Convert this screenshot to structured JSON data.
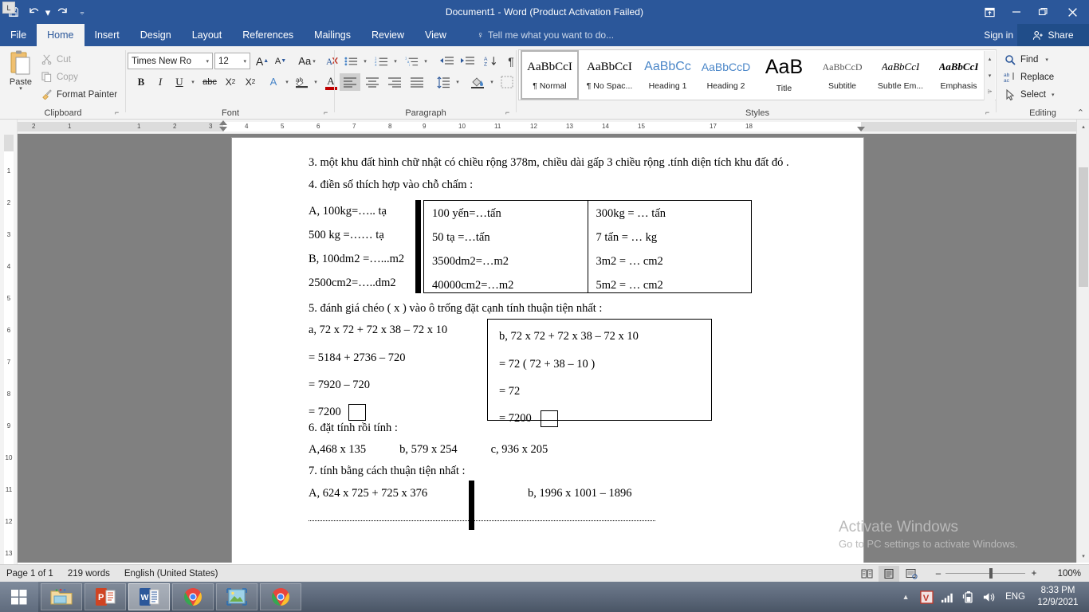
{
  "titlebar": {
    "document_title": "Document1 - Word (Product Activation Failed)",
    "qat": [
      {
        "name": "save",
        "label": "Save"
      },
      {
        "name": "undo",
        "label": "Undo"
      },
      {
        "name": "redo",
        "label": "Redo"
      },
      {
        "name": "customize",
        "label": "Customize Quick Access Toolbar"
      }
    ],
    "window_controls": [
      {
        "name": "ribbon-display-options",
        "label": "Ribbon Display Options"
      },
      {
        "name": "minimize",
        "label": "Minimize"
      },
      {
        "name": "restore",
        "label": "Restore Down"
      },
      {
        "name": "close",
        "label": "Close"
      }
    ]
  },
  "tabs": [
    {
      "label": "File",
      "active": false
    },
    {
      "label": "Home",
      "active": true
    },
    {
      "label": "Insert",
      "active": false
    },
    {
      "label": "Design",
      "active": false
    },
    {
      "label": "Layout",
      "active": false
    },
    {
      "label": "References",
      "active": false
    },
    {
      "label": "Mailings",
      "active": false
    },
    {
      "label": "Review",
      "active": false
    },
    {
      "label": "View",
      "active": false
    }
  ],
  "tellme": {
    "placeholder": "Tell me what you want to do..."
  },
  "account": {
    "signin": "Sign in",
    "share": "Share"
  },
  "ribbon": {
    "clipboard": {
      "group_label": "Clipboard",
      "paste_label": "Paste",
      "items": [
        {
          "label": "Cut",
          "icon": "scissors-icon",
          "enabled": false
        },
        {
          "label": "Copy",
          "icon": "copy-icon",
          "enabled": false
        },
        {
          "label": "Format Painter",
          "icon": "paintbrush-icon",
          "enabled": true
        }
      ]
    },
    "font": {
      "group_label": "Font",
      "font_name": "Times New Ro",
      "font_size": "12",
      "buttons": [
        {
          "name": "grow-font",
          "label": "A"
        },
        {
          "name": "shrink-font",
          "label": "A"
        },
        {
          "name": "change-case",
          "label": "Aa"
        },
        {
          "name": "clear-formatting",
          "label": "A"
        },
        {
          "name": "bold",
          "label": "B"
        },
        {
          "name": "italic",
          "label": "I"
        },
        {
          "name": "underline",
          "label": "U"
        },
        {
          "name": "strikethrough",
          "label": "abc"
        },
        {
          "name": "subscript",
          "label": "X2"
        },
        {
          "name": "superscript",
          "label": "X2"
        },
        {
          "name": "text-effects",
          "label": "A"
        },
        {
          "name": "text-highlight-color",
          "label": "ab"
        },
        {
          "name": "font-color",
          "label": "A"
        }
      ]
    },
    "paragraph": {
      "group_label": "Paragraph",
      "buttons": [
        {
          "name": "bullets"
        },
        {
          "name": "numbering"
        },
        {
          "name": "multilevel-list"
        },
        {
          "name": "decrease-indent"
        },
        {
          "name": "increase-indent"
        },
        {
          "name": "sort"
        },
        {
          "name": "show-formatting-marks"
        },
        {
          "name": "align-left"
        },
        {
          "name": "align-center"
        },
        {
          "name": "align-right"
        },
        {
          "name": "justify"
        },
        {
          "name": "line-spacing"
        },
        {
          "name": "shading"
        },
        {
          "name": "borders"
        }
      ]
    },
    "styles": {
      "group_label": "Styles",
      "items": [
        {
          "preview": "AaBbCcI",
          "name": "¶ Normal",
          "selected": true,
          "style": "serif-black"
        },
        {
          "preview": "AaBbCcI",
          "name": "¶ No Spac...",
          "selected": false,
          "style": "serif-black"
        },
        {
          "preview": "AaBbCc",
          "name": "Heading 1",
          "selected": false,
          "style": "sans-blue"
        },
        {
          "preview": "AaBbCcD",
          "name": "Heading 2",
          "selected": false,
          "style": "sans-blue"
        },
        {
          "preview": "AaB",
          "name": "Title",
          "selected": false,
          "style": "sans-big"
        },
        {
          "preview": "AaBbCcD",
          "name": "Subtitle",
          "selected": false,
          "style": "serif-small"
        },
        {
          "preview": "AaBbCcI",
          "name": "Subtle Em...",
          "selected": false,
          "style": "serif-italic"
        },
        {
          "preview": "AaBbCcI",
          "name": "Emphasis",
          "selected": false,
          "style": "serif-italic-bold"
        }
      ]
    },
    "editing": {
      "group_label": "Editing",
      "items": [
        {
          "label": "Find",
          "icon": "magnifier-icon",
          "has_caret": true
        },
        {
          "label": "Replace",
          "icon": "replace-icon",
          "has_caret": false
        },
        {
          "label": "Select",
          "icon": "cursor-icon",
          "has_caret": true
        }
      ]
    }
  },
  "ruler": {
    "horizontal_ticks": [
      "2",
      "1",
      "1",
      "2",
      "3",
      "4",
      "5",
      "6",
      "7",
      "8",
      "9",
      "10",
      "11",
      "12",
      "13",
      "14",
      "15",
      "17",
      "18"
    ],
    "vertical_ticks": [
      "1",
      "2",
      "3",
      "4",
      "5",
      "6",
      "7",
      "8",
      "9",
      "10",
      "11",
      "12",
      "13"
    ],
    "tab_selector": "L"
  },
  "document": {
    "q3": "3. một khu đất hình chữ nhật có chiều rộng 378m, chiều dài gấp 3 chiều rộng .tính diện tích khu đất đó .",
    "q4": "4. điền số thích hợp vào chỗ chấm :",
    "q4_left": [
      "A, 100kg=….. tạ",
      "500 kg =…… tạ",
      "B, 100dm2 =…...m2",
      "2500cm2=…..dm2"
    ],
    "q4_table_col1": [
      "100 yến=…tấn",
      "50 tạ =…tấn",
      "3500dm2=…m2",
      "40000cm2=…m2"
    ],
    "q4_table_col2": [
      "300kg = … tấn",
      "7 tấn = … kg",
      "3m2 = … cm2",
      "5m2 = … cm2"
    ],
    "q5": "5. đánh giá chéo ( x ) vào ô trống đặt cạnh tính thuậ tien nhất :",
    "q5_heading": "5. đánh giá chéo ( x ) vào ô trống đặt cạnh tính thuận tiện nhất :",
    "q5_left": [
      {
        "text": "a, 72 x 72 + 72 x 38 – 72 x 10",
        "box": false
      },
      {
        "text": "= 5184 + 2736 – 720",
        "box": false
      },
      {
        "text": "= 7920 – 720",
        "box": false
      },
      {
        "text": "= 7200",
        "box": true
      }
    ],
    "q5_box": [
      {
        "text": "b, 72 x 72 + 72 x 38 – 72 x 10",
        "box": false
      },
      {
        "text": "= 72 ( 72 + 38 – 10 )",
        "box": false
      },
      {
        "text": "= 72",
        "box": false
      },
      {
        "text": "= 7200",
        "box": true
      }
    ],
    "q6": "6. đặt tính rồi tính :",
    "q6_items": [
      "A,468 x 135",
      "b, 579 x 254",
      "c, 936 x 205"
    ],
    "q7": "7. tính bằng cách thuận tiện nhất :",
    "q7_a": "A, 624 x 725 + 725 x 376",
    "q7_b": "b, 1996 x 1001 – 1896"
  },
  "watermark": {
    "title": "Activate Windows",
    "subtitle": "Go to PC settings to activate Windows."
  },
  "statusbar": {
    "page": "Page 1 of 1",
    "words": "219 words",
    "language": "English (United States)",
    "views": [
      {
        "name": "read-mode",
        "active": false
      },
      {
        "name": "print-layout",
        "active": true
      },
      {
        "name": "web-layout",
        "active": false
      }
    ],
    "zoom_out": "–",
    "zoom_in": "+",
    "zoom_level": "100%"
  },
  "taskbar": {
    "apps": [
      {
        "name": "start-button",
        "icon": "windows-logo-icon",
        "active": false
      },
      {
        "name": "file-explorer",
        "icon": "folder-icon",
        "active": false
      },
      {
        "name": "powerpoint",
        "icon": "powerpoint-icon",
        "active": false
      },
      {
        "name": "word",
        "icon": "word-icon",
        "active": true
      },
      {
        "name": "chrome",
        "icon": "chrome-icon",
        "active": false
      },
      {
        "name": "photos",
        "icon": "photos-icon",
        "active": false
      },
      {
        "name": "chrome-2",
        "icon": "chrome-icon",
        "active": false
      }
    ],
    "tray": [
      {
        "name": "show-hidden-icons",
        "icon": "chevron-up-icon"
      },
      {
        "name": "unikey",
        "icon": "unikey-v-icon"
      },
      {
        "name": "network",
        "icon": "signal-bars-icon"
      },
      {
        "name": "battery",
        "icon": "battery-icon"
      },
      {
        "name": "volume",
        "icon": "speaker-icon"
      }
    ],
    "language": "ENG",
    "time": "8:33 PM",
    "date": "12/9/2021"
  },
  "colors": {
    "word_blue": "#2b579a",
    "ribbon_bg": "#f3f3f3",
    "accent_red": "#c0392b"
  }
}
